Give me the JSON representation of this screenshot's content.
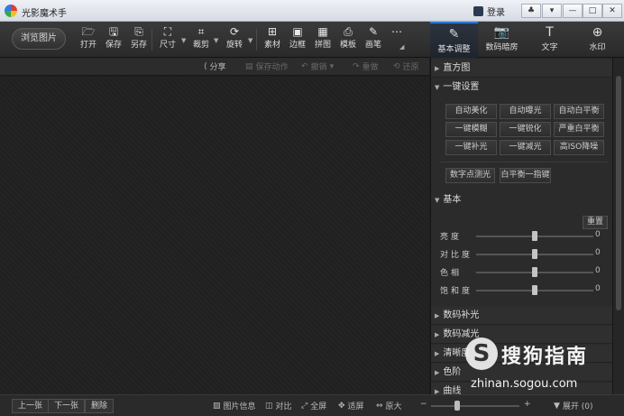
{
  "app": {
    "title": "光影魔术手",
    "login": "登录",
    "window_buttons": [
      "♣",
      "▾",
      "—",
      "□",
      "✕"
    ]
  },
  "toolbar": {
    "browse": "浏览图片",
    "tools": [
      {
        "label": "打开",
        "icon": "open-icon",
        "glyph": "🗁"
      },
      {
        "label": "保存",
        "icon": "save-icon",
        "glyph": "🖫"
      },
      {
        "label": "另存",
        "icon": "save-as-icon",
        "glyph": "⎘"
      },
      {
        "label": "尺寸",
        "icon": "resize-icon",
        "glyph": "⛶"
      },
      {
        "label": "裁剪",
        "icon": "crop-icon",
        "glyph": "⌗"
      },
      {
        "label": "旋转",
        "icon": "rotate-icon",
        "glyph": "⟳"
      },
      {
        "label": "素材",
        "icon": "material-icon",
        "glyph": "⊞"
      },
      {
        "label": "边框",
        "icon": "border-icon",
        "glyph": "▣"
      },
      {
        "label": "拼图",
        "icon": "collage-icon",
        "glyph": "▦"
      },
      {
        "label": "模板",
        "icon": "template-icon",
        "glyph": "⎙"
      },
      {
        "label": "画笔",
        "icon": "brush-icon",
        "glyph": "✎"
      },
      {
        "label": "",
        "icon": "more-icon",
        "glyph": "⋯"
      }
    ]
  },
  "right_tabs": [
    {
      "label": "基本调整",
      "icon": "adjust-icon",
      "glyph": "✎"
    },
    {
      "label": "数码暗房",
      "icon": "camera-icon",
      "glyph": "📷"
    },
    {
      "label": "文字",
      "icon": "text-icon",
      "glyph": "T"
    },
    {
      "label": "水印",
      "icon": "watermark-icon",
      "glyph": "⊕"
    }
  ],
  "actions": {
    "share": "分享",
    "save_action": "保存动作",
    "undo": "撤销",
    "redo": "重做",
    "restore": "还原"
  },
  "panel": {
    "histogram": "直方图",
    "one_click": "一键设置",
    "presets": [
      "自动美化",
      "自动曝光",
      "自动白平衡",
      "一键模糊",
      "一键锐化",
      "严重白平衡",
      "一键补光",
      "一键减光",
      "高ISO降噪"
    ],
    "extra_presets": [
      "数字点测光",
      "白平衡一指键"
    ],
    "basic": "基本",
    "reset": "重置",
    "sliders": [
      {
        "label": "亮度",
        "value": "0",
        "level": 0.5
      },
      {
        "label": "对比度",
        "value": "0",
        "level": 0.5
      },
      {
        "label": "色相",
        "value": "0",
        "level": 0.5
      },
      {
        "label": "饱和度",
        "value": "0",
        "level": 0.5
      }
    ],
    "collapsed": [
      "数码补光",
      "数码减光",
      "清晰度",
      "色阶",
      "曲线"
    ]
  },
  "bottom": {
    "prev": "上一张",
    "next": "下一张",
    "delete": "删除",
    "info": "图片信息",
    "compare": "对比",
    "fullscreen": "全屏",
    "fit": "适屏",
    "original": "原大",
    "zoom_minus": "−",
    "zoom_plus": "+",
    "expand": "展开 (0)"
  },
  "watermark": {
    "logo": "S",
    "text": "搜狗指南",
    "url": "zhinan.sogou.com"
  }
}
